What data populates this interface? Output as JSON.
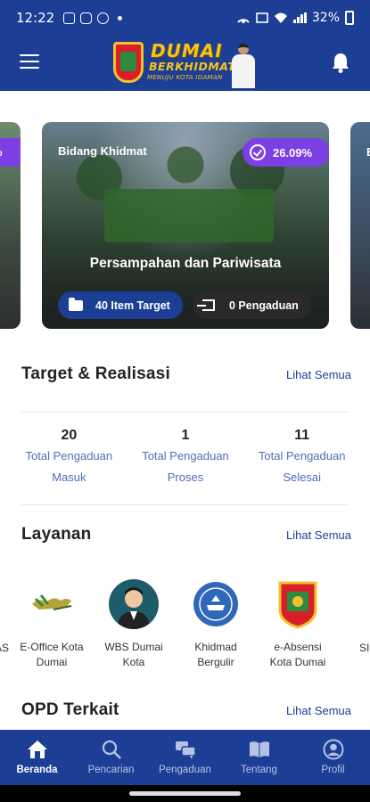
{
  "status_bar": {
    "time": "12:22",
    "battery": "32%"
  },
  "app_bar": {
    "logo_title": "DUMAI",
    "logo_subtitle": "BERKHIDMAT",
    "logo_tagline": "MENUJU KOTA IDAMAN"
  },
  "carousel": {
    "left_peek_badge": "%",
    "right_peek_label": "B",
    "slide": {
      "category": "Bidang Khidmat",
      "percent": "26.09%",
      "title": "Persampahan dan Pariwisata",
      "target_chip": "40 Item Target",
      "complaint_chip": "0 Pengaduan"
    }
  },
  "target_section": {
    "title": "Target & Realisasi",
    "see_all": "Lihat Semua",
    "stats": [
      {
        "value": "20",
        "label": "Total Pengaduan Masuk"
      },
      {
        "value": "1",
        "label": "Total Pengaduan Proses"
      },
      {
        "value": "11",
        "label": "Total Pengaduan Selesai"
      }
    ]
  },
  "services_section": {
    "title": "Layanan",
    "see_all": "Lihat Semua",
    "left_peek": "AS",
    "right_peek": "SI",
    "items": [
      {
        "label": "E-Office Kota Dumai",
        "icon": "eoffice-icon"
      },
      {
        "label": "WBS Dumai Kota",
        "icon": "user-avatar-icon"
      },
      {
        "label": "Khidmad Bergulir",
        "icon": "khidmad-logo-icon"
      },
      {
        "label": "e-Absensi Kota Dumai",
        "icon": "dumai-shield-icon"
      }
    ]
  },
  "opd_section": {
    "title": "OPD Terkait",
    "see_all": "Lihat Semua"
  },
  "bottom_nav": [
    {
      "label": "Beranda",
      "icon": "home-icon",
      "active": true
    },
    {
      "label": "Pencarian",
      "icon": "search-icon",
      "active": false
    },
    {
      "label": "Pengaduan",
      "icon": "chat-icon",
      "active": false
    },
    {
      "label": "Tentang",
      "icon": "book-icon",
      "active": false
    },
    {
      "label": "Profil",
      "icon": "profile-icon",
      "active": false
    }
  ],
  "colors": {
    "primary": "#1c3f95",
    "accent_purple": "#7b3fe4",
    "link": "#4c6fb5"
  }
}
